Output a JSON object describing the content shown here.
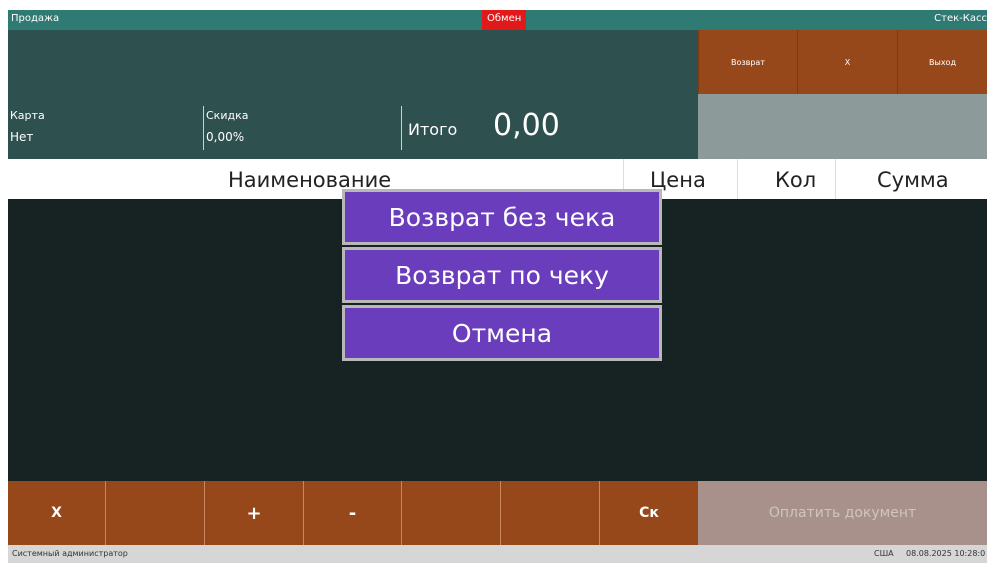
{
  "titlebar": {
    "left": "Продажа",
    "center": "Обмен",
    "right": "Стек-Касс"
  },
  "top_buttons": {
    "return": "Возврат",
    "x": "X",
    "exit": "Выход"
  },
  "info": {
    "card_label": "Карта",
    "card_value": "Нет",
    "discount_label": "Скидка",
    "discount_value": "0,00%",
    "total_label": "Итого",
    "total_value": "0,00"
  },
  "table": {
    "col_name": "Наименование",
    "col_price": "Цена",
    "col_qty": "Кол",
    "col_sum": "Сумма"
  },
  "dialog": {
    "option1": "Возврат без чека",
    "option2": "Возврат по чеку",
    "cancel": "Отмена"
  },
  "bottom": {
    "b1": "X",
    "b2": "",
    "b3": "+",
    "b4": "-",
    "b5": "",
    "b6": "",
    "b7": "Ск",
    "pay": "Оплатить документ"
  },
  "status": {
    "user": "Системный администратор",
    "region": "США",
    "datetime": "08.08.2025 10:28:0"
  },
  "colors": {
    "teal_bar": "#2f7a72",
    "panel": "#2e504f",
    "orange_button": "#97481b",
    "dialog": "#6a3dbc",
    "alert_red": "#e0191a"
  }
}
